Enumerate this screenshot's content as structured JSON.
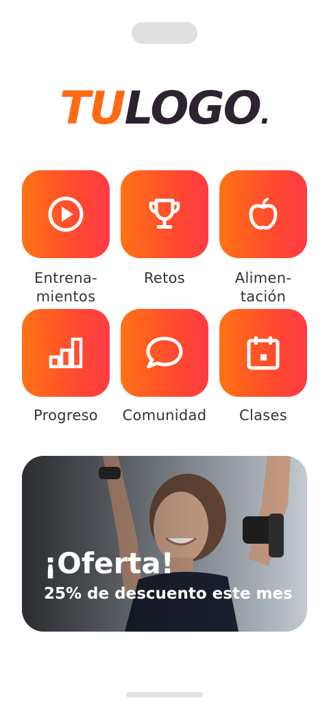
{
  "logo": {
    "part1": "TU",
    "part2": "LOGO",
    "dot": "."
  },
  "menu": [
    {
      "label": "Entrena-\nmientos",
      "icon": "play-circle-icon"
    },
    {
      "label": "Retos",
      "icon": "trophy-icon"
    },
    {
      "label": "Alimen-\ntación",
      "icon": "apple-icon"
    },
    {
      "label": "Progreso",
      "icon": "bar-chart-icon"
    },
    {
      "label": "Comunidad",
      "icon": "chat-bubble-icon"
    },
    {
      "label": "Clases",
      "icon": "calendar-icon"
    }
  ],
  "banner": {
    "title": "¡Oferta!",
    "subtitle": "25% de descuento este mes"
  },
  "colors": {
    "accent_start": "#ff7315",
    "accent_end": "#ff3a45",
    "logo_dark": "#2d2230"
  }
}
